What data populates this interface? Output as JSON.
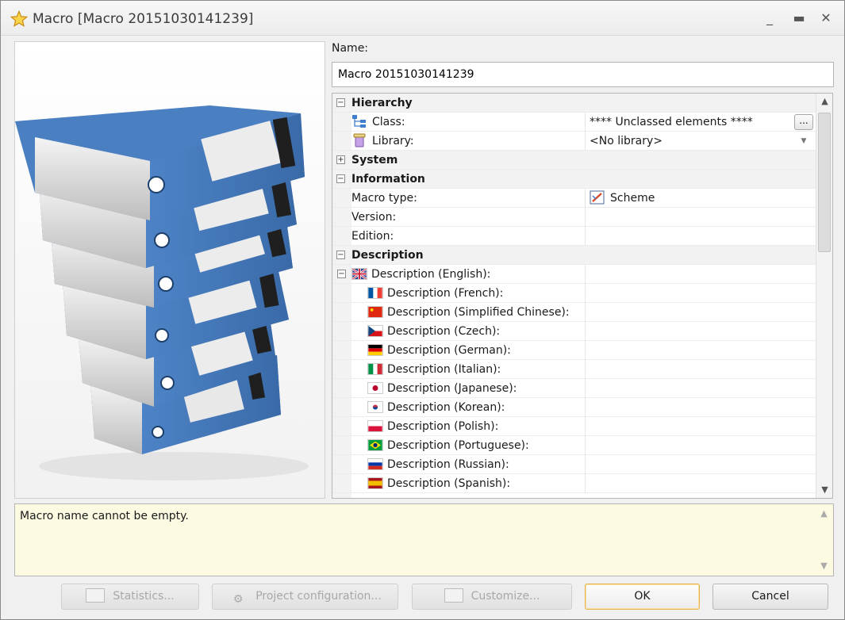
{
  "window": {
    "title": "Macro [Macro 20151030141239]",
    "icon": "star-icon",
    "controls": {
      "minimize": "_",
      "maximize": "▬",
      "close": "✕"
    }
  },
  "image_panel": {
    "icon": "binders-illustration"
  },
  "name": {
    "label": "Name:",
    "value": "Macro 20151030141239"
  },
  "properties": {
    "hierarchy": {
      "label": "Hierarchy",
      "expander": "−",
      "class": {
        "label": "Class:",
        "value": "**** Unclassed elements ****",
        "button": "..."
      },
      "library": {
        "label": "Library:",
        "value": "<No library>"
      }
    },
    "system": {
      "label": "System",
      "expander": "+"
    },
    "information": {
      "label": "Information",
      "expander": "−",
      "macro_type": {
        "label": "Macro type:",
        "value": "Scheme"
      },
      "version": {
        "label": "Version:",
        "value": ""
      },
      "edition": {
        "label": "Edition:",
        "value": ""
      }
    },
    "description": {
      "label": "Description",
      "expander": "−",
      "english": {
        "label": "Description (English):",
        "expander": "−"
      },
      "items": [
        {
          "label": "Description (French):",
          "flag": "flag-fr"
        },
        {
          "label": "Description (Simplified Chinese):",
          "flag": "flag-cn"
        },
        {
          "label": "Description (Czech):",
          "flag": "flag-cz"
        },
        {
          "label": "Description (German):",
          "flag": "flag-de"
        },
        {
          "label": "Description (Italian):",
          "flag": "flag-it"
        },
        {
          "label": "Description (Japanese):",
          "flag": "flag-jp"
        },
        {
          "label": "Description (Korean):",
          "flag": "flag-kr"
        },
        {
          "label": "Description (Polish):",
          "flag": "flag-pl"
        },
        {
          "label": "Description (Portuguese):",
          "flag": "flag-br"
        },
        {
          "label": "Description (Russian):",
          "flag": "flag-ru"
        },
        {
          "label": "Description (Spanish):",
          "flag": "flag-es"
        }
      ]
    }
  },
  "message": {
    "text": "Macro name cannot be empty."
  },
  "buttons": {
    "statistics": "Statistics...",
    "project_configuration": "Project configuration...",
    "customize": "Customize...",
    "ok": "OK",
    "cancel": "Cancel"
  },
  "colors": {
    "message_bg": "#fcfae1",
    "binder_blue": "#4a7fc1",
    "ok_border": "#e6b24a"
  }
}
